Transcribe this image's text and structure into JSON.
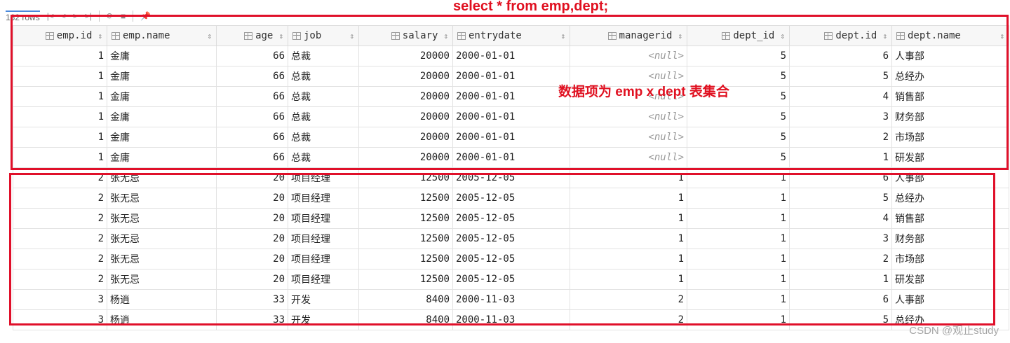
{
  "toolbar": {
    "rows_label": "162 rows"
  },
  "annotations": {
    "sql": "select * from emp,dept;",
    "note": "数据项为 emp x dept 表集合",
    "watermark": "CSDN @观止study"
  },
  "columns": [
    "emp.id",
    "emp.name",
    "age",
    "job",
    "salary",
    "entrydate",
    "managerid",
    "dept_id",
    "dept.id",
    "dept.name"
  ],
  "rows": [
    [
      "1",
      "金庸",
      "66",
      "总裁",
      "20000",
      "2000-01-01",
      "<null>",
      "5",
      "6",
      "人事部"
    ],
    [
      "1",
      "金庸",
      "66",
      "总裁",
      "20000",
      "2000-01-01",
      "<null>",
      "5",
      "5",
      "总经办"
    ],
    [
      "1",
      "金庸",
      "66",
      "总裁",
      "20000",
      "2000-01-01",
      "<null>",
      "5",
      "4",
      "销售部"
    ],
    [
      "1",
      "金庸",
      "66",
      "总裁",
      "20000",
      "2000-01-01",
      "<null>",
      "5",
      "3",
      "财务部"
    ],
    [
      "1",
      "金庸",
      "66",
      "总裁",
      "20000",
      "2000-01-01",
      "<null>",
      "5",
      "2",
      "市场部"
    ],
    [
      "1",
      "金庸",
      "66",
      "总裁",
      "20000",
      "2000-01-01",
      "<null>",
      "5",
      "1",
      "研发部"
    ],
    [
      "2",
      "张无忌",
      "20",
      "项目经理",
      "12500",
      "2005-12-05",
      "1",
      "1",
      "6",
      "人事部"
    ],
    [
      "2",
      "张无忌",
      "20",
      "项目经理",
      "12500",
      "2005-12-05",
      "1",
      "1",
      "5",
      "总经办"
    ],
    [
      "2",
      "张无忌",
      "20",
      "项目经理",
      "12500",
      "2005-12-05",
      "1",
      "1",
      "4",
      "销售部"
    ],
    [
      "2",
      "张无忌",
      "20",
      "项目经理",
      "12500",
      "2005-12-05",
      "1",
      "1",
      "3",
      "财务部"
    ],
    [
      "2",
      "张无忌",
      "20",
      "项目经理",
      "12500",
      "2005-12-05",
      "1",
      "1",
      "2",
      "市场部"
    ],
    [
      "2",
      "张无忌",
      "20",
      "项目经理",
      "12500",
      "2005-12-05",
      "1",
      "1",
      "1",
      "研发部"
    ],
    [
      "3",
      "杨逍",
      "33",
      "开发",
      "8400",
      "2000-11-03",
      "2",
      "1",
      "6",
      "人事部"
    ],
    [
      "3",
      "杨逍",
      "33",
      "开发",
      "8400",
      "2000-11-03",
      "2",
      "1",
      "5",
      "总经办"
    ]
  ]
}
